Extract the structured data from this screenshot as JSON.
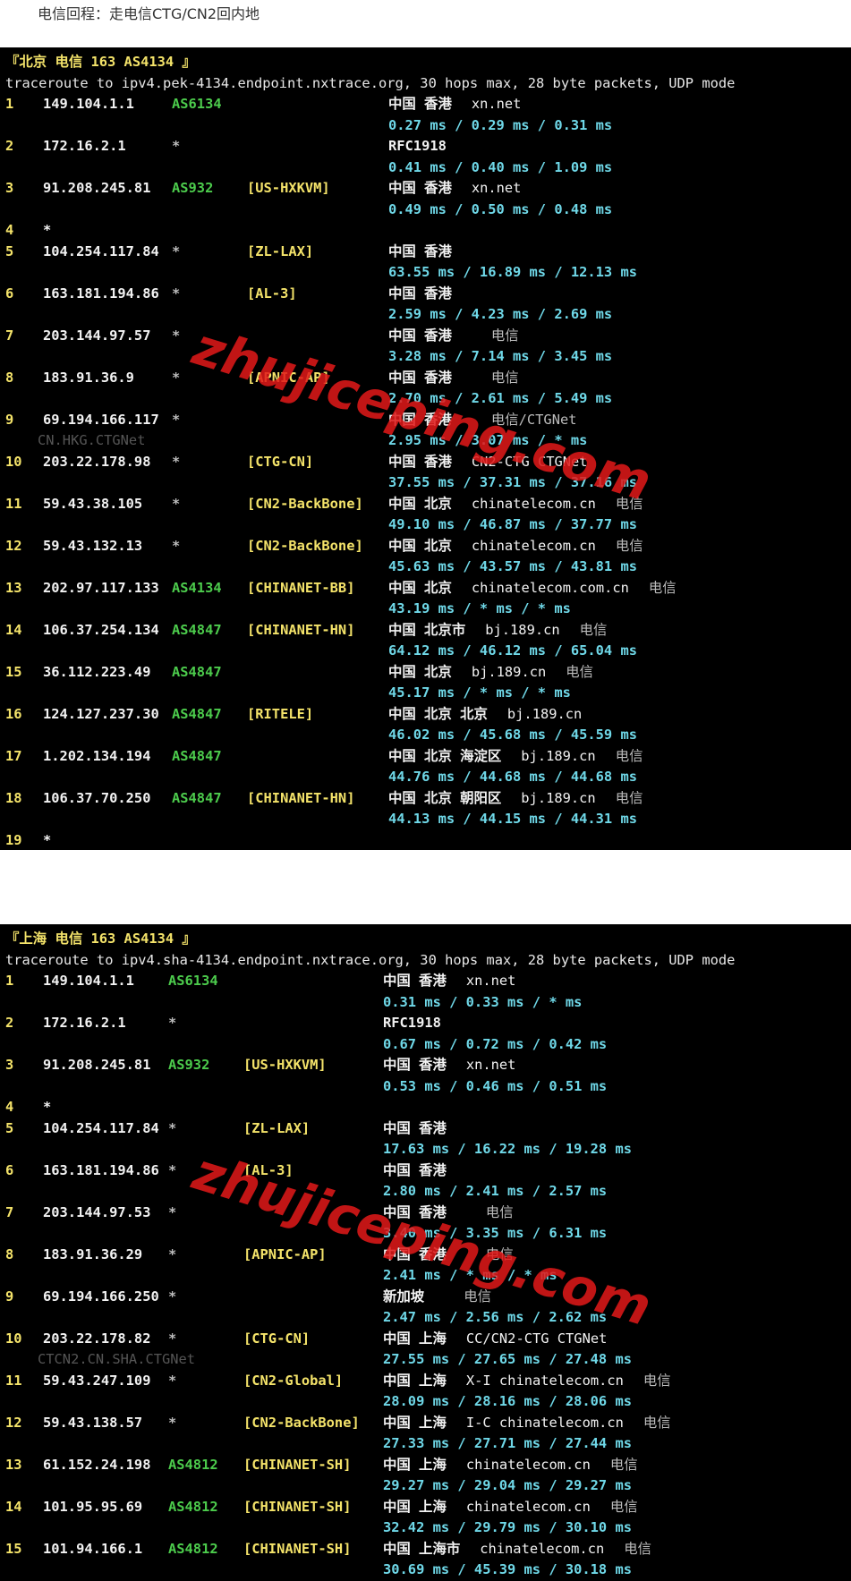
{
  "caption": "电信回程：走电信CTG/CN2回内地",
  "watermark": "zhujiceping.com",
  "traces": [
    {
      "header": "『北京 电信 163 AS4134 』",
      "command": "traceroute to ipv4.pek-4134.endpoint.nxtrace.org, 30 hops max, 28 byte packets, UDP mode",
      "hops": [
        {
          "n": "1",
          "ip": "149.104.1.1",
          "asn": "AS6134",
          "tag": "",
          "geo": "中国 香港",
          "host": "xn.net",
          "isp": "",
          "rtt": "0.27 ms / 0.29 ms / 0.31 ms",
          "sub": ""
        },
        {
          "n": "2",
          "ip": "172.16.2.1",
          "asn": "*",
          "tag": "",
          "geo": "RFC1918",
          "host": "",
          "isp": "",
          "rtt": "0.41 ms / 0.40 ms / 1.09 ms",
          "sub": ""
        },
        {
          "n": "3",
          "ip": "91.208.245.81",
          "asn": "AS932",
          "tag": "[US-HXKVM]",
          "geo": "中国 香港",
          "host": "xn.net",
          "isp": "",
          "rtt": "0.49 ms / 0.50 ms / 0.48 ms",
          "sub": ""
        },
        {
          "n": "4",
          "ip": "*",
          "asn": "",
          "tag": "",
          "geo": "",
          "host": "",
          "isp": "",
          "rtt": "",
          "sub": ""
        },
        {
          "n": "5",
          "ip": "104.254.117.84",
          "asn": "*",
          "tag": "[ZL-LAX]",
          "geo": "中国 香港",
          "host": "",
          "isp": "",
          "rtt": "63.55 ms / 16.89 ms / 12.13 ms",
          "sub": ""
        },
        {
          "n": "6",
          "ip": "163.181.194.86",
          "asn": "*",
          "tag": "[AL-3]",
          "geo": "中国 香港",
          "host": "",
          "isp": "",
          "rtt": "2.59 ms / 4.23 ms / 2.69 ms",
          "sub": ""
        },
        {
          "n": "7",
          "ip": "203.144.97.57",
          "asn": "*",
          "tag": "",
          "geo": "中国 香港",
          "host": "",
          "isp": "电信",
          "rtt": "3.28 ms / 7.14 ms / 3.45 ms",
          "sub": ""
        },
        {
          "n": "8",
          "ip": "183.91.36.9",
          "asn": "*",
          "tag": "[APNIC-AP]",
          "geo": "中国 香港",
          "host": "",
          "isp": "电信",
          "rtt": "2.70 ms / 2.61 ms / 5.49 ms",
          "sub": ""
        },
        {
          "n": "9",
          "ip": "69.194.166.117",
          "asn": "*",
          "tag": "",
          "geo": "中国 香港",
          "host": "",
          "isp": "电信/CTGNet",
          "rtt": "2.95 ms / 3.07 ms / * ms",
          "sub": "CN.HKG.CTGNet"
        },
        {
          "n": "10",
          "ip": "203.22.178.98",
          "asn": "*",
          "tag": "[CTG-CN]",
          "geo": "中国 香港",
          "host": "CN2-CTG CTGNet",
          "isp": "",
          "rtt": "37.55 ms / 37.31 ms / 37.16 ms",
          "sub": ""
        },
        {
          "n": "11",
          "ip": "59.43.38.105",
          "asn": "*",
          "tag": "[CN2-BackBone]",
          "geo": "中国 北京",
          "host": "chinatelecom.cn",
          "isp": "电信",
          "rtt": "49.10 ms / 46.87 ms / 37.77 ms",
          "sub": ""
        },
        {
          "n": "12",
          "ip": "59.43.132.13",
          "asn": "*",
          "tag": "[CN2-BackBone]",
          "geo": "中国 北京",
          "host": "chinatelecom.cn",
          "isp": "电信",
          "rtt": "45.63 ms / 43.57 ms / 43.81 ms",
          "sub": ""
        },
        {
          "n": "13",
          "ip": "202.97.117.133",
          "asn": "AS4134",
          "tag": "[CHINANET-BB]",
          "geo": "中国 北京",
          "host": "chinatelecom.com.cn",
          "isp": "电信",
          "rtt": "43.19 ms / * ms / * ms",
          "sub": ""
        },
        {
          "n": "14",
          "ip": "106.37.254.134",
          "asn": "AS4847",
          "tag": "[CHINANET-HN]",
          "geo": "中国 北京市",
          "host": "bj.189.cn",
          "isp": "电信",
          "rtt": "64.12 ms / 46.12 ms / 65.04 ms",
          "sub": ""
        },
        {
          "n": "15",
          "ip": "36.112.223.49",
          "asn": "AS4847",
          "tag": "",
          "geo": "中国 北京",
          "host": "bj.189.cn",
          "isp": "电信",
          "rtt": "45.17 ms / * ms / * ms",
          "sub": ""
        },
        {
          "n": "16",
          "ip": "124.127.237.30",
          "asn": "AS4847",
          "tag": "[RITELE]",
          "geo": "中国 北京 北京",
          "host": "bj.189.cn",
          "isp": "",
          "rtt": "46.02 ms / 45.68 ms / 45.59 ms",
          "sub": ""
        },
        {
          "n": "17",
          "ip": "1.202.134.194",
          "asn": "AS4847",
          "tag": "",
          "geo": "中国 北京 海淀区",
          "host": "bj.189.cn",
          "isp": "电信",
          "rtt": "44.76 ms / 44.68 ms / 44.68 ms",
          "sub": ""
        },
        {
          "n": "18",
          "ip": "106.37.70.250",
          "asn": "AS4847",
          "tag": "[CHINANET-HN]",
          "geo": "中国 北京 朝阳区",
          "host": "bj.189.cn",
          "isp": "电信",
          "rtt": "44.13 ms / 44.15 ms / 44.31 ms",
          "sub": ""
        },
        {
          "n": "19",
          "ip": "*",
          "asn": "",
          "tag": "",
          "geo": "",
          "host": "",
          "isp": "",
          "rtt": "",
          "sub": ""
        }
      ]
    },
    {
      "header": "『上海 电信 163 AS4134 』",
      "command": "traceroute to ipv4.sha-4134.endpoint.nxtrace.org, 30 hops max, 28 byte packets, UDP mode",
      "hops": [
        {
          "n": "1",
          "ip": "149.104.1.1",
          "asn": "AS6134",
          "tag": "",
          "geo": "中国 香港",
          "host": "xn.net",
          "isp": "",
          "rtt": "0.31 ms / 0.33 ms / * ms",
          "sub": ""
        },
        {
          "n": "2",
          "ip": "172.16.2.1",
          "asn": "*",
          "tag": "",
          "geo": "RFC1918",
          "host": "",
          "isp": "",
          "rtt": "0.67 ms / 0.72 ms / 0.42 ms",
          "sub": ""
        },
        {
          "n": "3",
          "ip": "91.208.245.81",
          "asn": "AS932",
          "tag": "[US-HXKVM]",
          "geo": "中国 香港",
          "host": "xn.net",
          "isp": "",
          "rtt": "0.53 ms / 0.46 ms / 0.51 ms",
          "sub": ""
        },
        {
          "n": "4",
          "ip": "*",
          "asn": "",
          "tag": "",
          "geo": "",
          "host": "",
          "isp": "",
          "rtt": "",
          "sub": ""
        },
        {
          "n": "5",
          "ip": "104.254.117.84",
          "asn": "*",
          "tag": "[ZL-LAX]",
          "geo": "中国 香港",
          "host": "",
          "isp": "",
          "rtt": "17.63 ms / 16.22 ms / 19.28 ms",
          "sub": ""
        },
        {
          "n": "6",
          "ip": "163.181.194.86",
          "asn": "*",
          "tag": "[AL-3]",
          "geo": "中国 香港",
          "host": "",
          "isp": "",
          "rtt": "2.80 ms / 2.41 ms / 2.57 ms",
          "sub": ""
        },
        {
          "n": "7",
          "ip": "203.144.97.53",
          "asn": "*",
          "tag": "",
          "geo": "中国 香港",
          "host": "",
          "isp": "电信",
          "rtt": "3.40 ms / 3.35 ms / 6.31 ms",
          "sub": ""
        },
        {
          "n": "8",
          "ip": "183.91.36.29",
          "asn": "*",
          "tag": "[APNIC-AP]",
          "geo": "中国 香港",
          "host": "",
          "isp": "电信",
          "rtt": "2.41 ms / * ms / * ms",
          "sub": ""
        },
        {
          "n": "9",
          "ip": "69.194.166.250",
          "asn": "*",
          "tag": "",
          "geo": "新加坡",
          "host": "",
          "isp": "电信",
          "rtt": "2.47 ms / 2.56 ms / 2.62 ms",
          "sub": ""
        },
        {
          "n": "10",
          "ip": "203.22.178.82",
          "asn": "*",
          "tag": "[CTG-CN]",
          "geo": "中国 上海",
          "host": "CC/CN2-CTG CTGNet",
          "isp": "",
          "rtt": "27.55 ms / 27.65 ms / 27.48 ms",
          "sub": "CTCN2.CN.SHA.CTGNet"
        },
        {
          "n": "11",
          "ip": "59.43.247.109",
          "asn": "*",
          "tag": "[CN2-Global]",
          "geo": "中国 上海",
          "host": "X-I chinatelecom.cn",
          "isp": "电信",
          "rtt": "28.09 ms / 28.16 ms / 28.06 ms",
          "sub": ""
        },
        {
          "n": "12",
          "ip": "59.43.138.57",
          "asn": "*",
          "tag": "[CN2-BackBone]",
          "geo": "中国 上海",
          "host": "I-C chinatelecom.cn",
          "isp": "电信",
          "rtt": "27.33 ms / 27.71 ms / 27.44 ms",
          "sub": ""
        },
        {
          "n": "13",
          "ip": "61.152.24.198",
          "asn": "AS4812",
          "tag": "[CHINANET-SH]",
          "geo": "中国 上海",
          "host": "chinatelecom.cn",
          "isp": "电信",
          "rtt": "29.27 ms / 29.04 ms / 29.27 ms",
          "sub": ""
        },
        {
          "n": "14",
          "ip": "101.95.95.69",
          "asn": "AS4812",
          "tag": "[CHINANET-SH]",
          "geo": "中国 上海",
          "host": "chinatelecom.cn",
          "isp": "电信",
          "rtt": "32.42 ms / 29.79 ms / 30.10 ms",
          "sub": ""
        },
        {
          "n": "15",
          "ip": "101.94.166.1",
          "asn": "AS4812",
          "tag": "[CHINANET-SH]",
          "geo": "中国 上海市",
          "host": "chinatelecom.cn",
          "isp": "电信",
          "rtt": "30.69 ms / 45.39 ms / 30.18 ms",
          "sub": ""
        }
      ]
    }
  ]
}
